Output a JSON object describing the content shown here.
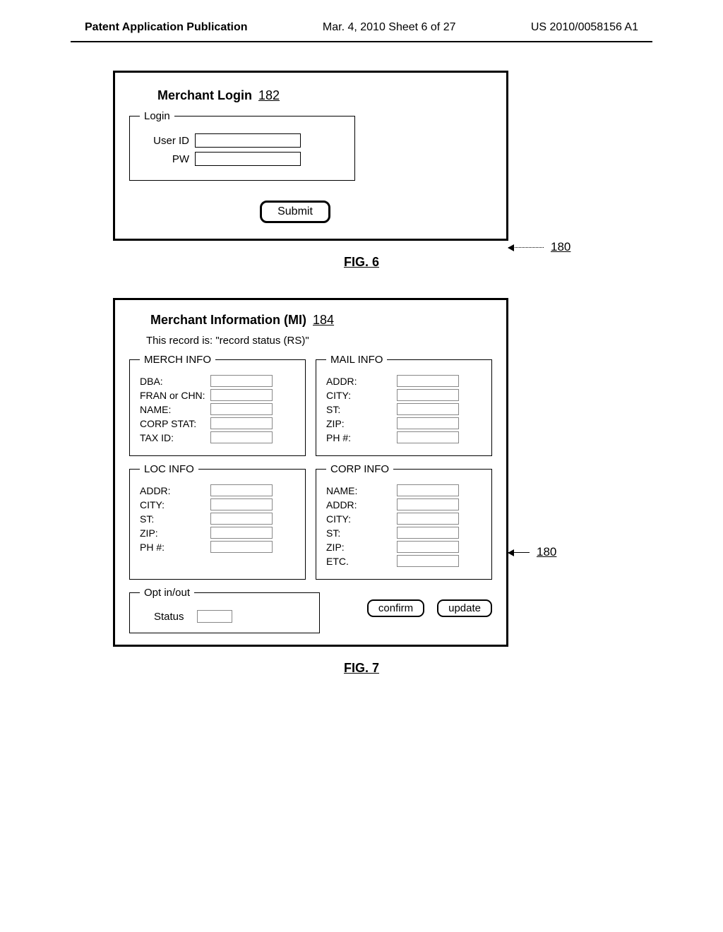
{
  "header": {
    "left": "Patent Application Publication",
    "center": "Mar. 4, 2010  Sheet 6 of 27",
    "right": "US 2010/0058156 A1"
  },
  "fig6": {
    "title": "Merchant Login",
    "ref": "182",
    "legend": "Login",
    "userid_label": "User ID",
    "pw_label": "PW",
    "submit": "Submit",
    "callout": "180",
    "caption": "FIG. 6"
  },
  "fig7": {
    "title": "Merchant Information (MI)",
    "ref": "184",
    "subtitle": "This record is: \"record status (RS)\"",
    "merch": {
      "legend": "MERCH INFO",
      "rows": [
        "DBA:",
        "FRAN or CHN:",
        "NAME:",
        "CORP STAT:",
        "TAX ID:"
      ]
    },
    "mail": {
      "legend": "MAIL INFO",
      "rows": [
        "ADDR:",
        "CITY:",
        "ST:",
        "ZIP:",
        "PH #:"
      ]
    },
    "loc": {
      "legend": "LOC INFO",
      "rows": [
        "ADDR:",
        "CITY:",
        "ST:",
        "ZIP:",
        "PH #:"
      ]
    },
    "corp": {
      "legend": "CORP INFO",
      "rows": [
        "NAME:",
        "ADDR:",
        "CITY:",
        "ST:",
        "ZIP:",
        "ETC."
      ]
    },
    "opt": {
      "legend": "Opt in/out",
      "status": "Status"
    },
    "confirm": "confirm",
    "update": "update",
    "callout": "180",
    "caption": "FIG. 7"
  }
}
